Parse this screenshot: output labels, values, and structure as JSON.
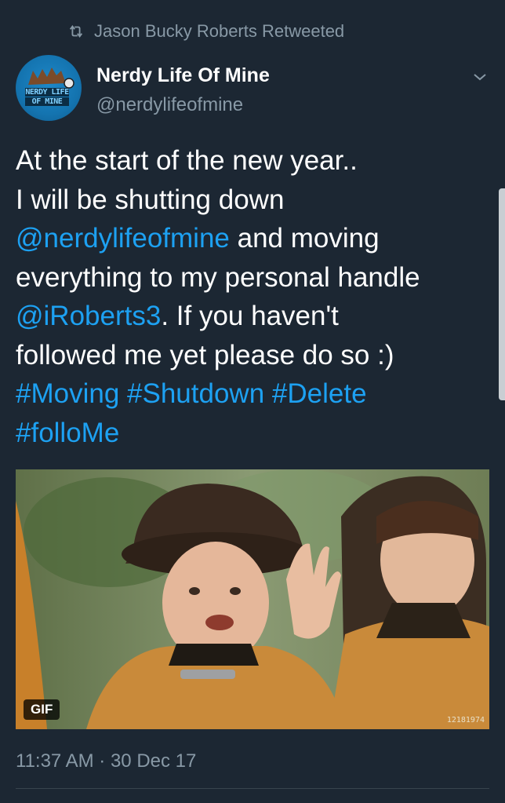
{
  "retweet": {
    "label": "Jason Bucky Roberts Retweeted"
  },
  "author": {
    "display_name": "Nerdy Life Of Mine",
    "handle": "@nerdylifeofmine",
    "avatar_logo_text": [
      "NERDY LIFE",
      "OF MINE"
    ]
  },
  "tweet": {
    "segments": [
      {
        "text": "At the start of the new year..\nI will be shutting down\n",
        "link": false
      },
      {
        "text": "@nerdylifeofmine",
        "link": true
      },
      {
        "text": " and moving\neverything to my personal handle\n",
        "link": false
      },
      {
        "text": "@iRoberts3",
        "link": true
      },
      {
        "text": ". If you haven't\nfollowed me yet please do so :)\n",
        "link": false
      },
      {
        "text": "#Moving",
        "link": true
      },
      {
        "text": " ",
        "link": false
      },
      {
        "text": "#Shutdown",
        "link": true
      },
      {
        "text": " ",
        "link": false
      },
      {
        "text": "#Delete",
        "link": true
      },
      {
        "text": "\n",
        "link": false
      },
      {
        "text": "#folloMe",
        "link": true
      }
    ]
  },
  "media": {
    "badge": "GIF",
    "watermark": "12181974"
  },
  "timestamp": "11:37 AM · 30 Dec 17",
  "colors": {
    "background": "#1c2733",
    "link": "#1da1f2",
    "secondary_text": "#8899a6"
  },
  "icons": {
    "retweet": "retweet-icon",
    "menu": "chevron-down-icon"
  }
}
